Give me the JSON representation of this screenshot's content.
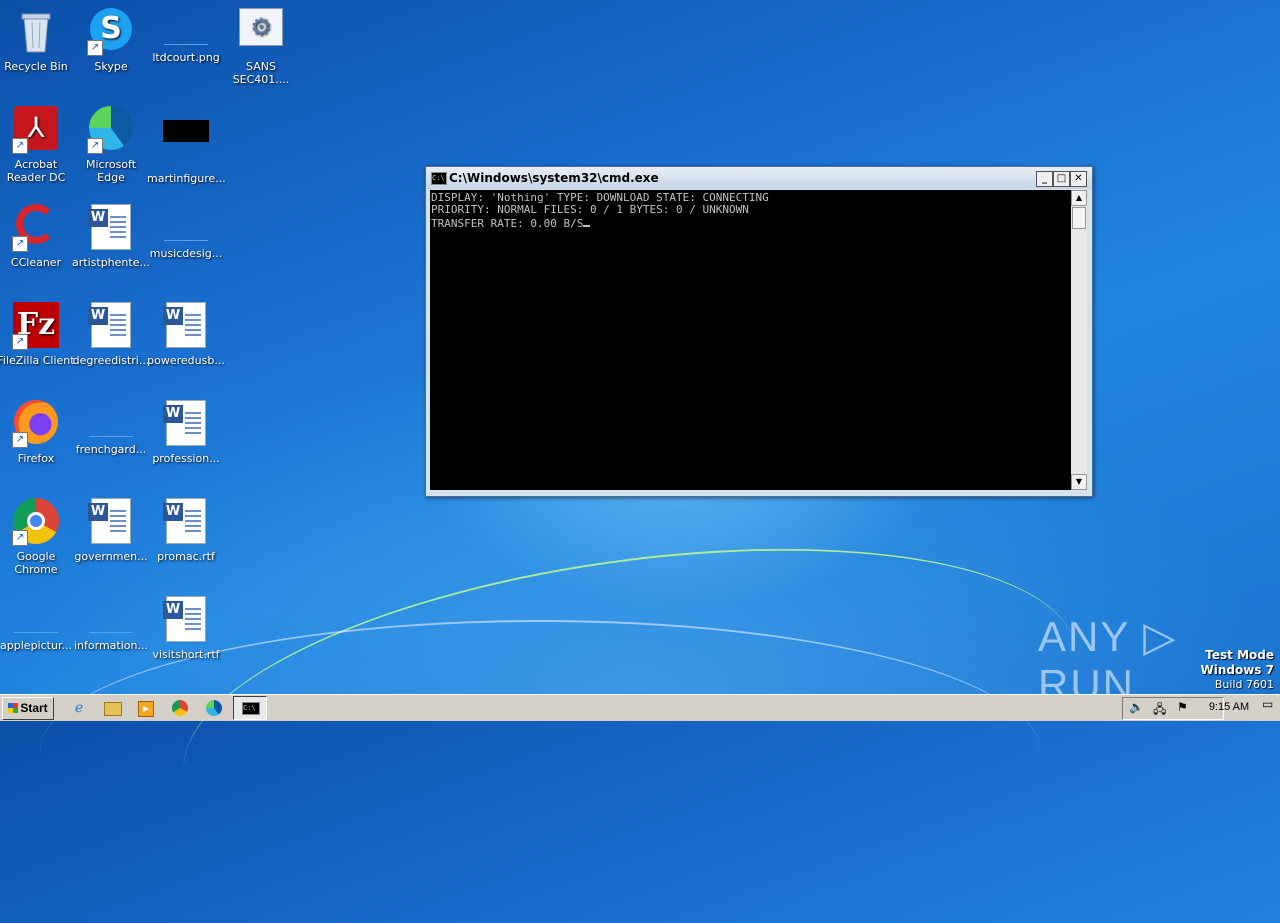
{
  "desktop": {
    "icons": [
      {
        "label": "Recycle Bin"
      },
      {
        "label": "Skype"
      },
      {
        "label": "ltdcourt.png"
      },
      {
        "label": "SANS SEC401...."
      },
      {
        "label": "Acrobat Reader DC"
      },
      {
        "label": "Microsoft Edge"
      },
      {
        "label": "martinfigure..."
      },
      {
        "label": "CCleaner"
      },
      {
        "label": "artistphente..."
      },
      {
        "label": "musicdesig..."
      },
      {
        "label": "FileZilla Client"
      },
      {
        "label": "degreedistri..."
      },
      {
        "label": "poweredusb..."
      },
      {
        "label": "Firefox"
      },
      {
        "label": "frenchgard..."
      },
      {
        "label": "profession..."
      },
      {
        "label": "Google Chrome"
      },
      {
        "label": "governmen..."
      },
      {
        "label": "promac.rtf"
      },
      {
        "label": "applepictur..."
      },
      {
        "label": "information..."
      },
      {
        "label": "visitshort.rtf"
      }
    ]
  },
  "cmd_window": {
    "title": "C:\\Windows\\system32\\cmd.exe",
    "lines": [
      "DISPLAY: 'Nothing' TYPE: DOWNLOAD STATE: CONNECTING",
      "PRIORITY: NORMAL FILES: 0 / 1 BYTES: 0 / UNKNOWN",
      "TRANSFER RATE: 0.00 B/S"
    ]
  },
  "watermark": {
    "brand": "ANY ▷ RUN",
    "test_mode": "Test Mode",
    "os": "Windows 7",
    "build": "Build 7601"
  },
  "taskbar": {
    "start_label": "Start",
    "clock": "9:15 AM"
  }
}
